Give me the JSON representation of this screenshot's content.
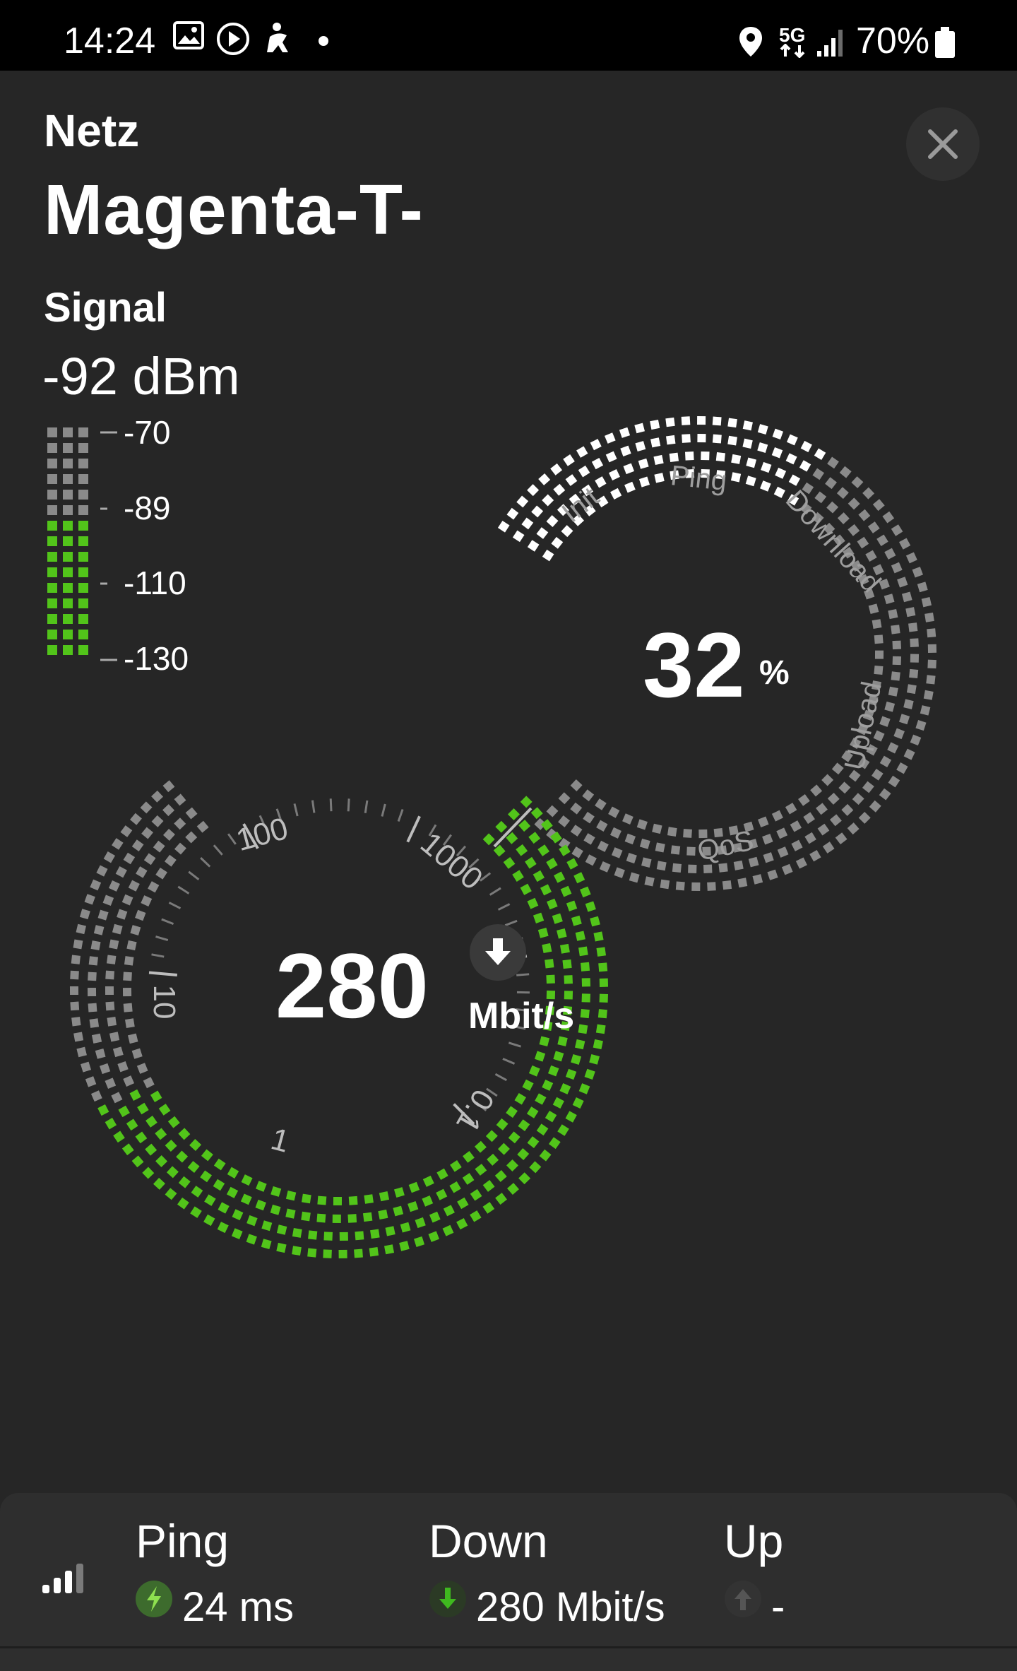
{
  "status_bar": {
    "time": "14:24",
    "network_type": "5G",
    "battery": "70%",
    "icons": [
      "image-icon",
      "play-icon",
      "accessibility-icon",
      "notification-dot-icon",
      "location-icon",
      "5g-icon",
      "signal-bars-icon",
      "battery-icon"
    ]
  },
  "header": {
    "netz_label": "Netz",
    "network_name": "Magenta-T-",
    "close_icon": "close-icon"
  },
  "signal": {
    "label": "Signal",
    "value": "-92 dBm",
    "scale": [
      "-70",
      "-89",
      "-110",
      "-130"
    ],
    "level_fraction": 0.62,
    "colors": {
      "active": "#52c41a",
      "inactive": "#8a8a8a"
    }
  },
  "progress_gauge": {
    "value": "32",
    "unit": "%",
    "value_fraction": 0.32,
    "phases": [
      "Init",
      "Ping",
      "Download",
      "Upload",
      "QoS"
    ]
  },
  "speed_gauge": {
    "value": "280",
    "unit": "Mbit/s",
    "direction_icon": "arrow-down-icon",
    "scale_labels": [
      "0.1",
      "1",
      "10",
      "100",
      "1000"
    ],
    "accent_color": "#52c41a"
  },
  "results": {
    "signal_icon": "signal-strength-icon",
    "ping": {
      "label": "Ping",
      "value": "24 ms",
      "icon": "ping-icon"
    },
    "down": {
      "label": "Down",
      "value": "280 Mbit/s",
      "icon": "download-arrow-icon"
    },
    "up": {
      "label": "Up",
      "value": "-",
      "icon": "upload-arrow-icon"
    }
  }
}
